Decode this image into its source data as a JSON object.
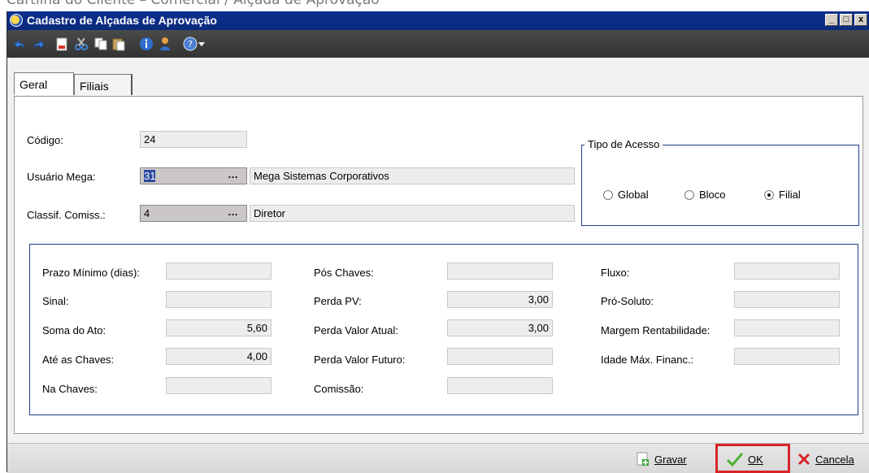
{
  "doc_caption": "Cartilha do Cliente – Comercial / Alçada de Aprovação",
  "window": {
    "title": "Cadastro de Alçadas de Aprovação",
    "controls": [
      "_",
      "□",
      "x"
    ]
  },
  "toolbar": {
    "icons": [
      "undo-icon",
      "redo-icon",
      "new-document-icon",
      "cut-icon",
      "copy-icon",
      "paste-icon",
      "info-icon",
      "user-icon",
      "help-icon",
      "dropdown-arrow-icon"
    ]
  },
  "tabs": [
    {
      "label": "Geral",
      "active": true
    },
    {
      "label": "Filiais",
      "active": false
    }
  ],
  "form": {
    "codigo": {
      "label": "Código:",
      "value": "24"
    },
    "usuario": {
      "label": "Usuário Mega:",
      "code": "31",
      "lookup": "…",
      "description": "Mega Sistemas Corporativos"
    },
    "classif": {
      "label": "Classif. Comiss.:",
      "code": "4",
      "lookup": "…",
      "description": "Diretor"
    }
  },
  "tipo_acesso": {
    "legend": "Tipo de Acesso",
    "options": [
      {
        "label": "Global",
        "checked": false
      },
      {
        "label": "Bloco",
        "checked": false
      },
      {
        "label": "Filial",
        "checked": true
      }
    ]
  },
  "params": {
    "col1": [
      {
        "label": "Prazo Mínimo (dias):",
        "value": ""
      },
      {
        "label": "Sinal:",
        "value": ""
      },
      {
        "label": "Soma do Ato:",
        "value": "5,60"
      },
      {
        "label": "Até as Chaves:",
        "value": "4,00"
      },
      {
        "label": "Na Chaves:",
        "value": ""
      }
    ],
    "col2": [
      {
        "label": "Pós Chaves:",
        "value": ""
      },
      {
        "label": "Perda PV:",
        "value": "3,00"
      },
      {
        "label": "Perda Valor Atual:",
        "value": "3,00"
      },
      {
        "label": "Perda Valor Futuro:",
        "value": ""
      },
      {
        "label": "Comissão:",
        "value": ""
      }
    ],
    "col3": [
      {
        "label": "Fluxo:",
        "value": ""
      },
      {
        "label": "Pró-Soluto:",
        "value": ""
      },
      {
        "label": "Margem Rentabilidade:",
        "value": ""
      },
      {
        "label": "Idade Máx. Financ.:",
        "value": ""
      }
    ]
  },
  "footer": {
    "gravar_label": "Gravar",
    "ok_label": "OK",
    "cancelar_label": "Cancela"
  },
  "colors": {
    "titlebar": "#0c2f8f",
    "groupbox_border": "#1d3f8a",
    "highlight": "#d9242a"
  }
}
